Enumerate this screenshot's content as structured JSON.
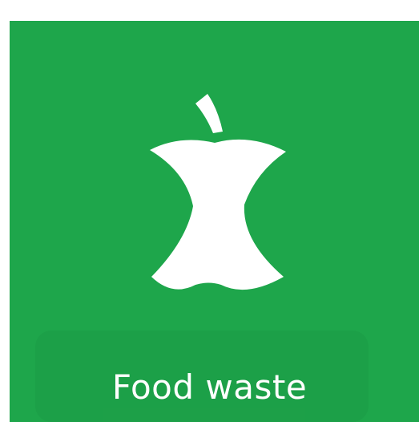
{
  "tile": {
    "label": "Food waste",
    "background_color": "#1ea64b",
    "icon": "apple-core-icon",
    "icon_color": "#ffffff"
  }
}
